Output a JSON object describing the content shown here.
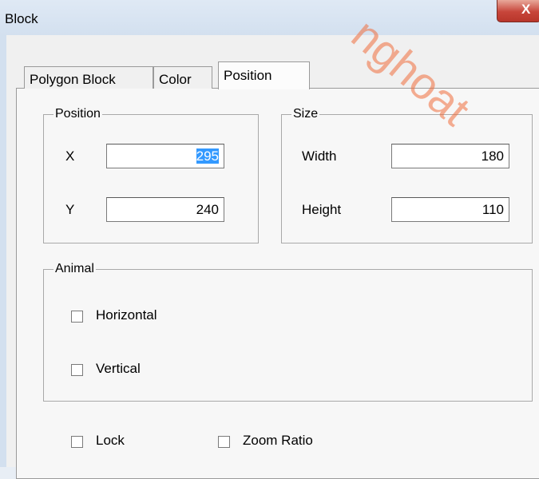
{
  "window": {
    "title": "Block",
    "close_glyph": "X"
  },
  "tabs": [
    {
      "label": "Polygon Block",
      "active": false
    },
    {
      "label": "Color",
      "active": false
    },
    {
      "label": "Position",
      "active": true
    }
  ],
  "position_group": {
    "legend": "Position",
    "x_label": "X",
    "x_value": "295",
    "y_label": "Y",
    "y_value": "240"
  },
  "size_group": {
    "legend": "Size",
    "width_label": "Width",
    "width_value": "180",
    "height_label": "Height",
    "height_value": "110"
  },
  "animal_group": {
    "legend": "Animal",
    "horizontal_label": "Horizontal",
    "horizontal_checked": false,
    "vertical_label": "Vertical",
    "vertical_checked": false
  },
  "options": {
    "lock_label": "Lock",
    "lock_checked": false,
    "zoom_ratio_label": "Zoom Ratio",
    "zoom_ratio_checked": false
  },
  "watermark": "nghoat",
  "colors": {
    "accent_selection": "#3399ff",
    "close_button": "#c7453a",
    "watermark": "#f06e3c"
  }
}
